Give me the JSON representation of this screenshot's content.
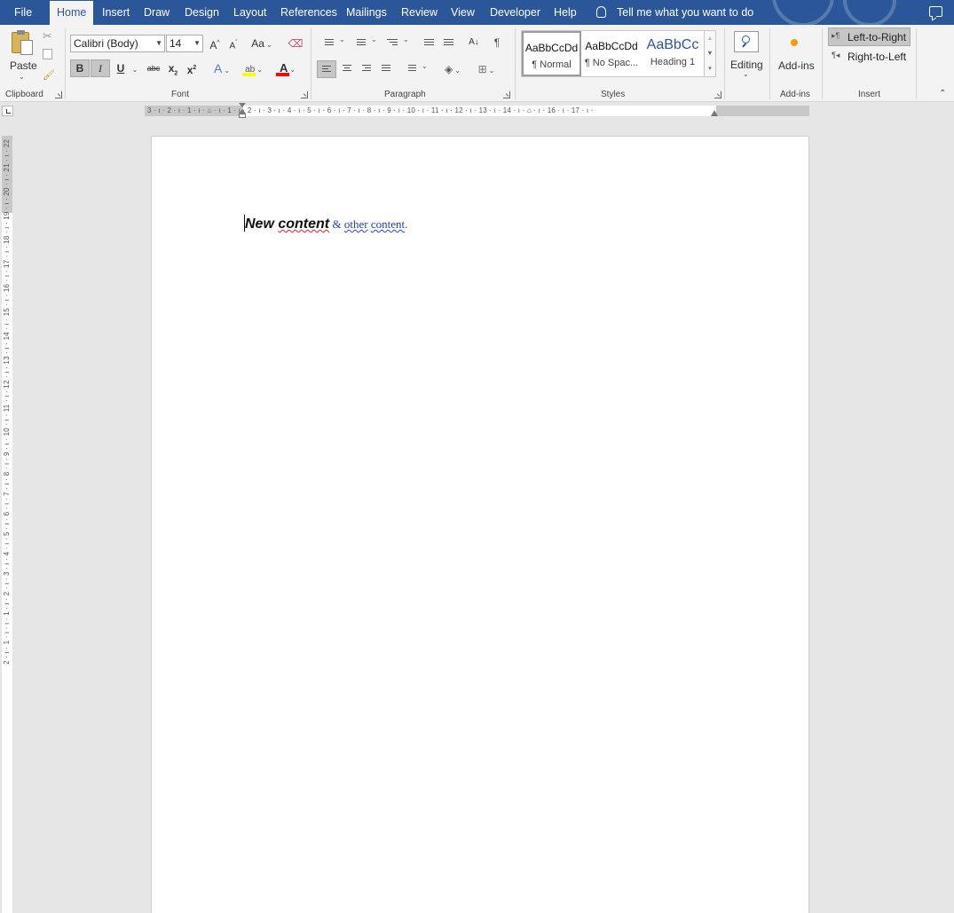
{
  "menu": {
    "tabs": [
      "File",
      "Home",
      "Insert",
      "Draw",
      "Design",
      "Layout",
      "References",
      "Mailings",
      "Review",
      "View",
      "Developer",
      "Help"
    ],
    "active_tab": "Home",
    "tell_me": "Tell me what you want to do"
  },
  "clipboard": {
    "paste_label": "Paste",
    "group_label": "Clipboard"
  },
  "font": {
    "font_name": "Calibri (Body)",
    "font_size": "14",
    "grow": "A",
    "shrink": "A",
    "change_case": "Aa",
    "bold": "B",
    "italic": "I",
    "underline": "U",
    "strike": "abc",
    "subscript": "x",
    "superscript": "x",
    "font_color": "A",
    "group_label": "Font"
  },
  "paragraph": {
    "group_label": "Paragraph",
    "sort": "A↓",
    "pilcrow": "¶"
  },
  "styles": {
    "items": [
      {
        "preview": "AaBbCcDd",
        "name": "¶ Normal"
      },
      {
        "preview": "AaBbCcDd",
        "name": "¶ No Spac..."
      },
      {
        "preview": "AaBbCc",
        "name": "Heading 1"
      }
    ],
    "group_label": "Styles"
  },
  "editing": {
    "label": "Editing"
  },
  "addins": {
    "label": "Add-ins",
    "group_label": "Add-ins"
  },
  "insert": {
    "ltr": "Left-to-Right",
    "rtl": "Right-to-Left",
    "group_label": "Insert"
  },
  "ruler": {
    "horizontal": "3 · ı · 2 · ı · 1 · ı · ⌂ · ı · 1 · ı · 2 · ı · 3 · ı · 4 · ı · 5 · ı · 6 · ı · 7 · ı · 8 · ı · 9 · ı · 10 · ı · 11 · ı · 12 · ı · 13 · ı · 14 · ı · ⌂ · ı · 16 · ı · 17 · ı ·",
    "vertical": "2 · ı · 1 · ı · ı · 1 · ı · 2 · ı · 3 · ı · 4 · ı · 5 · ı · 6 · ı · 7 · ı · 8 · ı · 9 · ı · 10 · ı · 11 · ı · 12 · ı · 13 · ı · 14 · ı · 15 · ı · 16 · ı · 17 · ı · 18 · ı · 19 · ı · 20 · ı · 21 · ı · 22"
  },
  "document": {
    "text_part1_word1": "New",
    "text_part1_word2": "content",
    "text_part2_amp": "&",
    "text_part2_word1": "other",
    "text_part2_word2": "content",
    "text_part2_period": "."
  },
  "colors": {
    "title_bar": "#2b579a",
    "ribbon": "#f3f3f3",
    "highlight": "#ffff00",
    "font_color_bar": "#ff0000",
    "link_text": "#1f3ec6"
  }
}
